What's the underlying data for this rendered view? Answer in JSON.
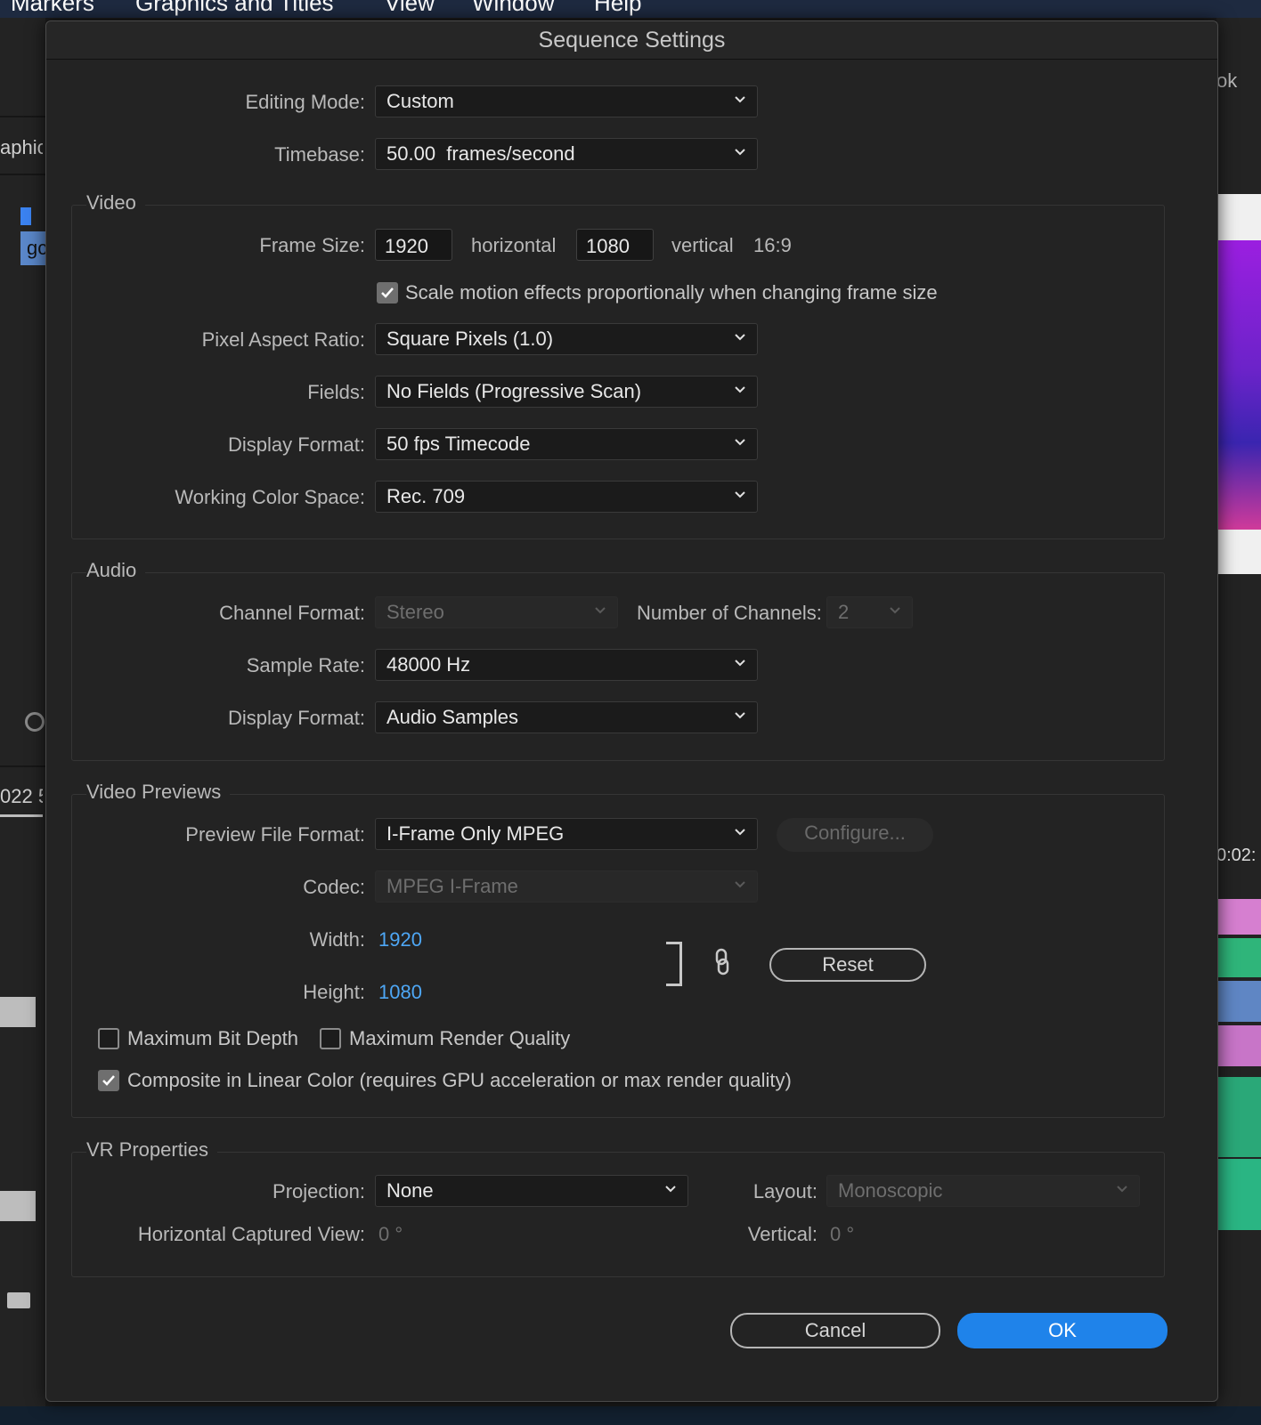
{
  "menubar": {
    "items": [
      "Markers",
      "Graphics and Titles",
      "View",
      "Window",
      "Help"
    ]
  },
  "background": {
    "left_text_1": "aphic",
    "left_text_2": "gc",
    "left_text_3": "022 5",
    "right_text_1": "ok",
    "right_text_2": "0:02:"
  },
  "dialog": {
    "title": "Sequence Settings",
    "editing_mode": {
      "label": "Editing Mode:",
      "value": "Custom"
    },
    "timebase": {
      "label": "Timebase:",
      "value": "50.00  frames/second"
    },
    "video": {
      "section_title": "Video",
      "frame_size_label": "Frame Size:",
      "width": "1920",
      "horizontal_label": "horizontal",
      "height": "1080",
      "vertical_label": "vertical",
      "aspect": "16:9",
      "scale_motion": {
        "label": "Scale motion effects proportionally when changing frame size",
        "checked": true
      },
      "pixel_aspect": {
        "label": "Pixel Aspect Ratio:",
        "value": "Square Pixels (1.0)"
      },
      "fields": {
        "label": "Fields:",
        "value": "No Fields (Progressive Scan)"
      },
      "display_format": {
        "label": "Display Format:",
        "value": "50 fps Timecode"
      },
      "color_space": {
        "label": "Working Color Space:",
        "value": "Rec. 709"
      }
    },
    "audio": {
      "section_title": "Audio",
      "channel_format": {
        "label": "Channel Format:",
        "value": "Stereo"
      },
      "num_channels": {
        "label": "Number of Channels:",
        "value": "2"
      },
      "sample_rate": {
        "label": "Sample Rate:",
        "value": "48000 Hz"
      },
      "display_format": {
        "label": "Display Format:",
        "value": "Audio Samples"
      }
    },
    "previews": {
      "section_title": "Video Previews",
      "file_format": {
        "label": "Preview File Format:",
        "value": "I-Frame Only MPEG"
      },
      "configure_label": "Configure...",
      "codec": {
        "label": "Codec:",
        "value": "MPEG I-Frame"
      },
      "width": {
        "label": "Width:",
        "value": "1920"
      },
      "height": {
        "label": "Height:",
        "value": "1080"
      },
      "reset_label": "Reset",
      "max_bit_depth": {
        "label": "Maximum Bit Depth",
        "checked": false
      },
      "max_render_quality": {
        "label": "Maximum Render Quality",
        "checked": false
      },
      "composite_linear": {
        "label": "Composite in Linear Color (requires GPU acceleration or max render quality)",
        "checked": true
      }
    },
    "vr": {
      "section_title": "VR Properties",
      "projection": {
        "label": "Projection:",
        "value": "None"
      },
      "layout": {
        "label": "Layout:",
        "value": "Monoscopic"
      },
      "h_view": {
        "label": "Horizontal Captured View:",
        "value": "0 °"
      },
      "vertical": {
        "label": "Vertical:",
        "value": "0 °"
      }
    },
    "cancel_label": "Cancel",
    "ok_label": "OK"
  },
  "colors": {
    "accent": "#1f83ea",
    "link": "#4ea7f5",
    "dialog_bg": "#232323"
  }
}
